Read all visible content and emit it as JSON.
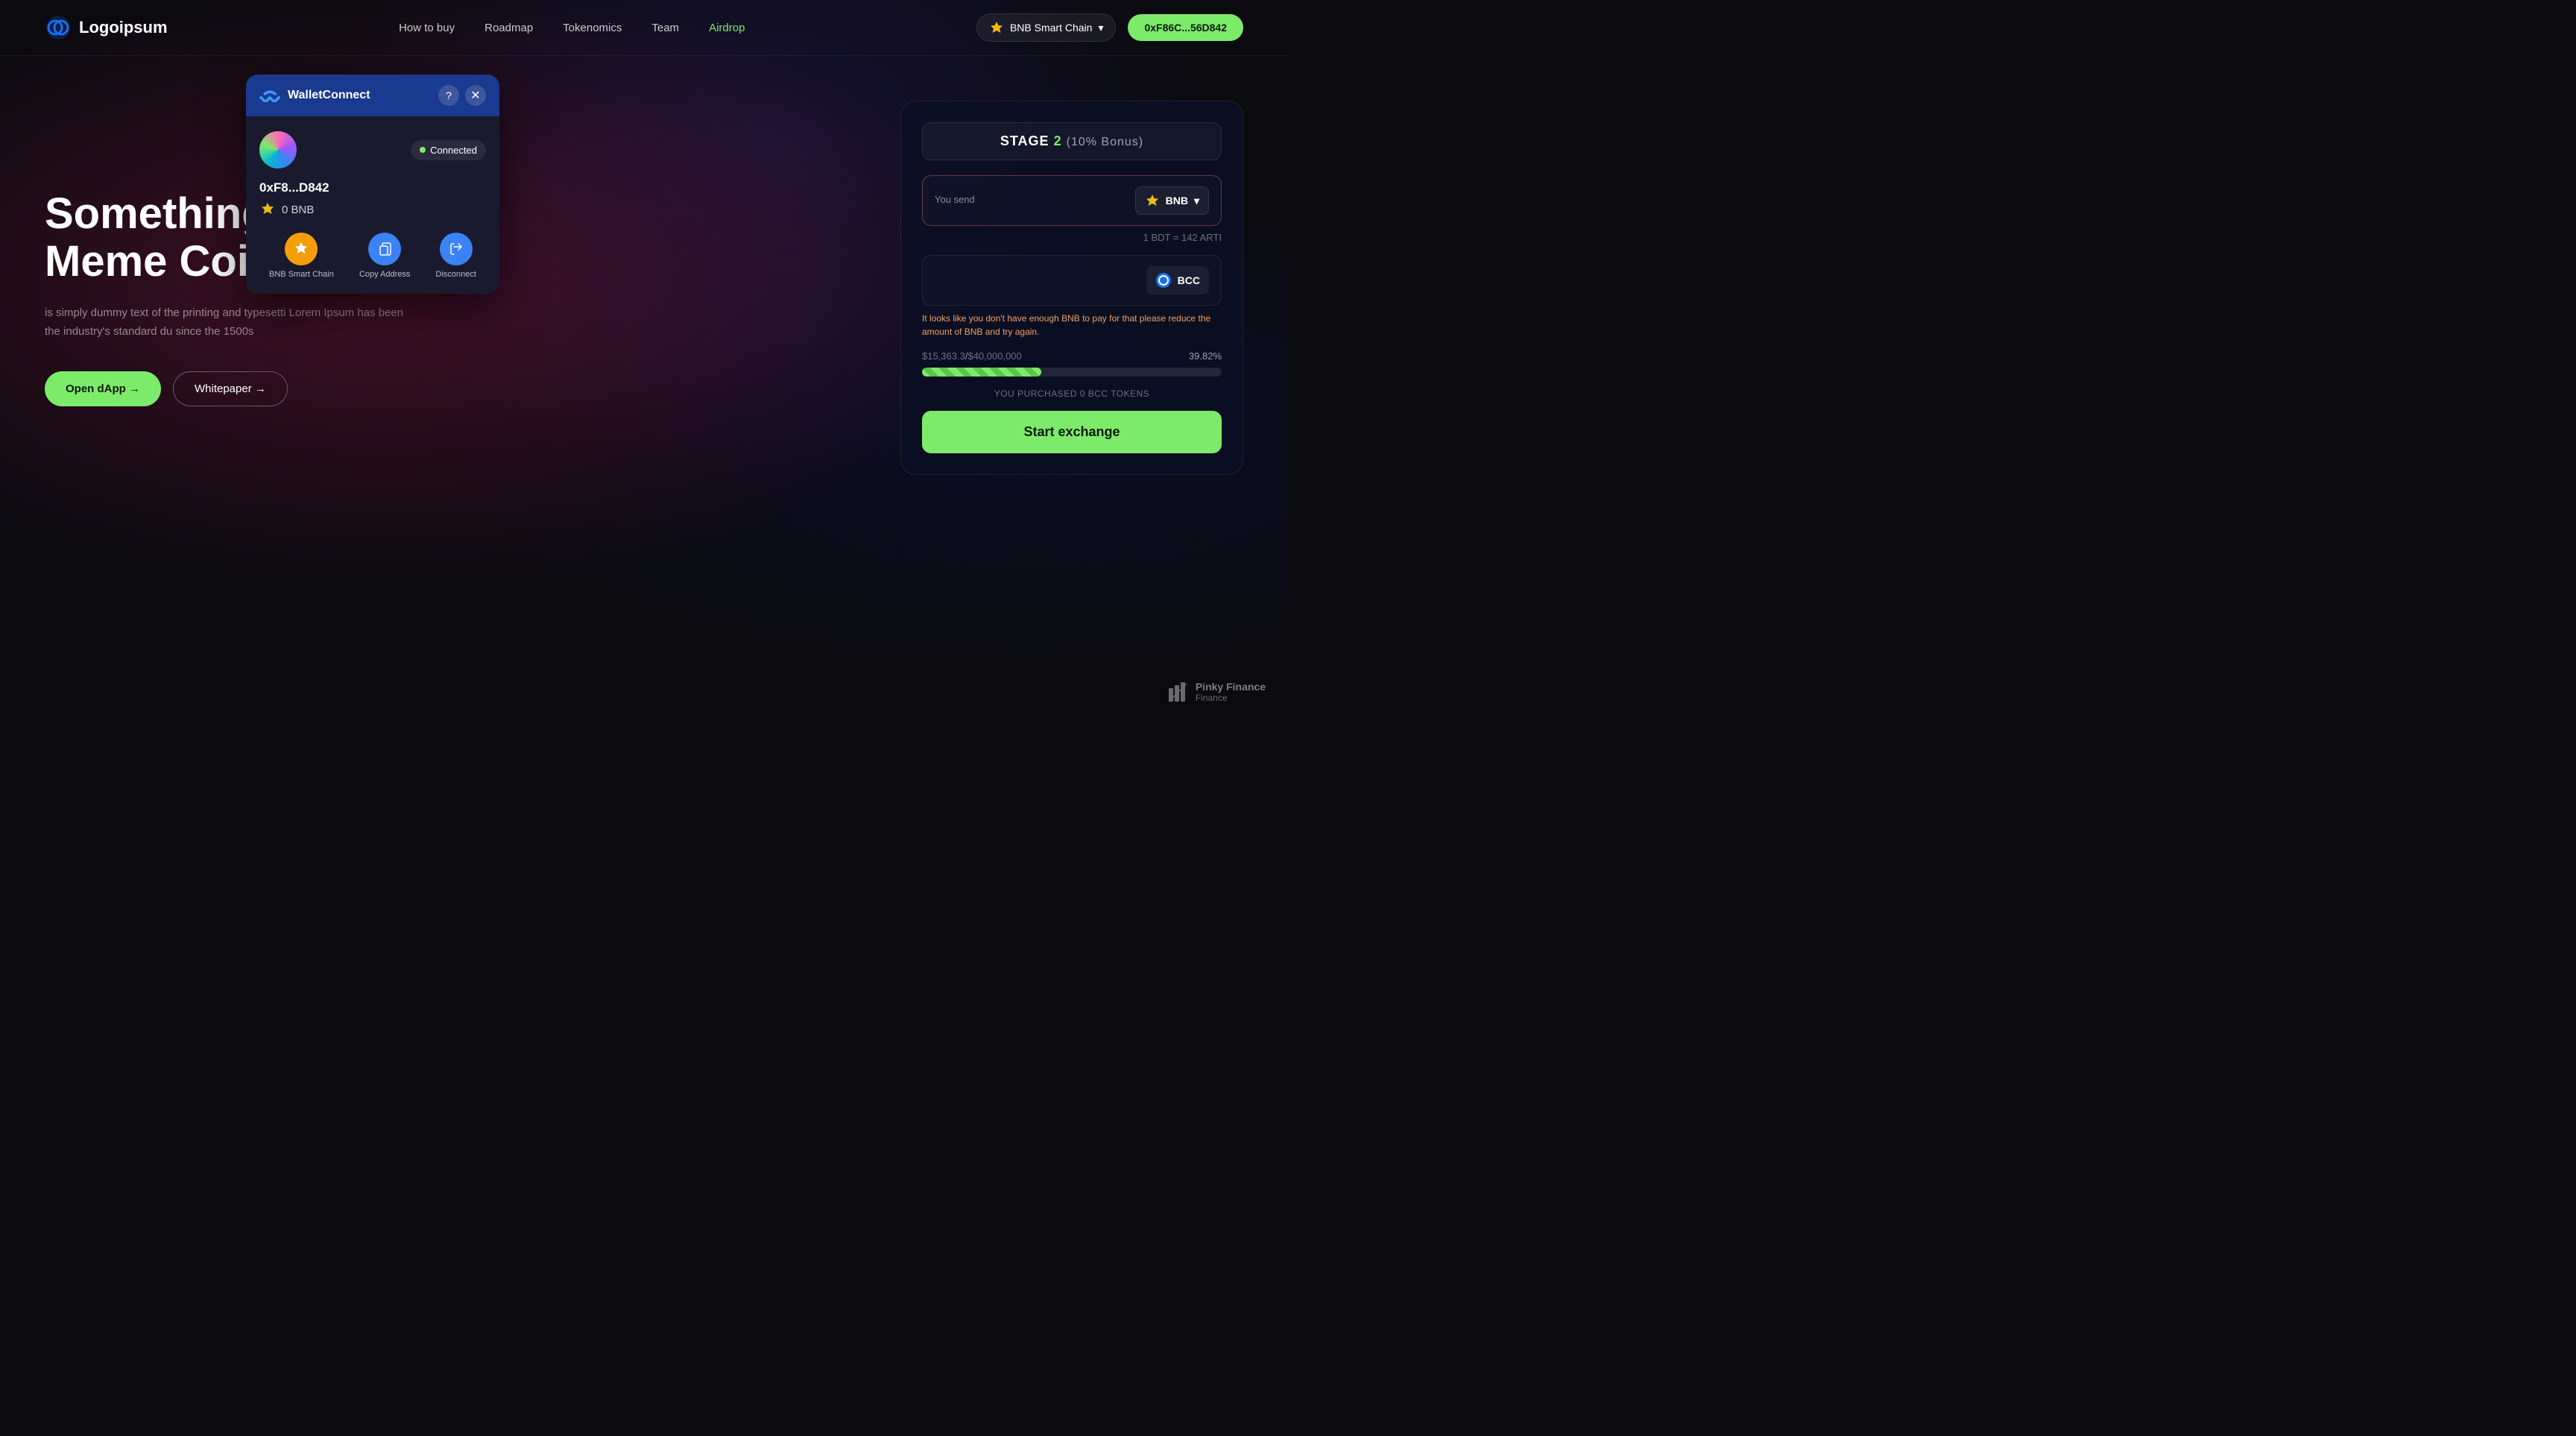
{
  "brand": {
    "logo_text": "Logoipsum"
  },
  "navbar": {
    "links": [
      {
        "label": "How to buy",
        "active": false
      },
      {
        "label": "Roadmap",
        "active": false
      },
      {
        "label": "Tokenomics",
        "active": false
      },
      {
        "label": "Team",
        "active": false
      },
      {
        "label": "Airdrop",
        "active": true
      }
    ],
    "chain": {
      "label": "BNB Smart Chain",
      "chevron": "▾"
    },
    "wallet_address": "0xF86C...56D842"
  },
  "hero": {
    "title_line1": "Something Better Th",
    "title_line2": "Meme Coin",
    "description": "is simply dummy text of the printing and typesetti Lorem Ipsum has been the industry's standard du since the 1500s",
    "cta_primary": "Open dApp →",
    "cta_secondary": "Whitepaper →"
  },
  "widget": {
    "stage_label": "STAGE",
    "stage_num": "2",
    "stage_bonus": "(10% Bonus)",
    "send_label": "You send",
    "token_bnb": "BNB",
    "rate_text": "1 BDT = 142 ARTI",
    "receive_token": "BCC",
    "warning": "It looks like you don't have enough BNB to pay for that please reduce the amount of BNB and try again.",
    "progress_amount": "$15,363.3",
    "progress_goal": "$40,000,000",
    "progress_pct": "39.82%",
    "purchased_text": "YOU PURCHASED 0 BCC TOKENS",
    "exchange_btn": "Start exchange"
  },
  "walletconnect": {
    "title": "WalletConnect",
    "connected_label": "Connected",
    "address": "0xF8...D842",
    "balance": "0 BNB",
    "actions": [
      {
        "label": "BNB Smart Chain",
        "icon": "chain"
      },
      {
        "label": "Copy Address",
        "icon": "copy"
      },
      {
        "label": "Disconnect",
        "icon": "disconnect"
      }
    ],
    "help_btn": "?",
    "close_btn": "✕"
  },
  "footer": {
    "brand": "Pinky Finance"
  }
}
